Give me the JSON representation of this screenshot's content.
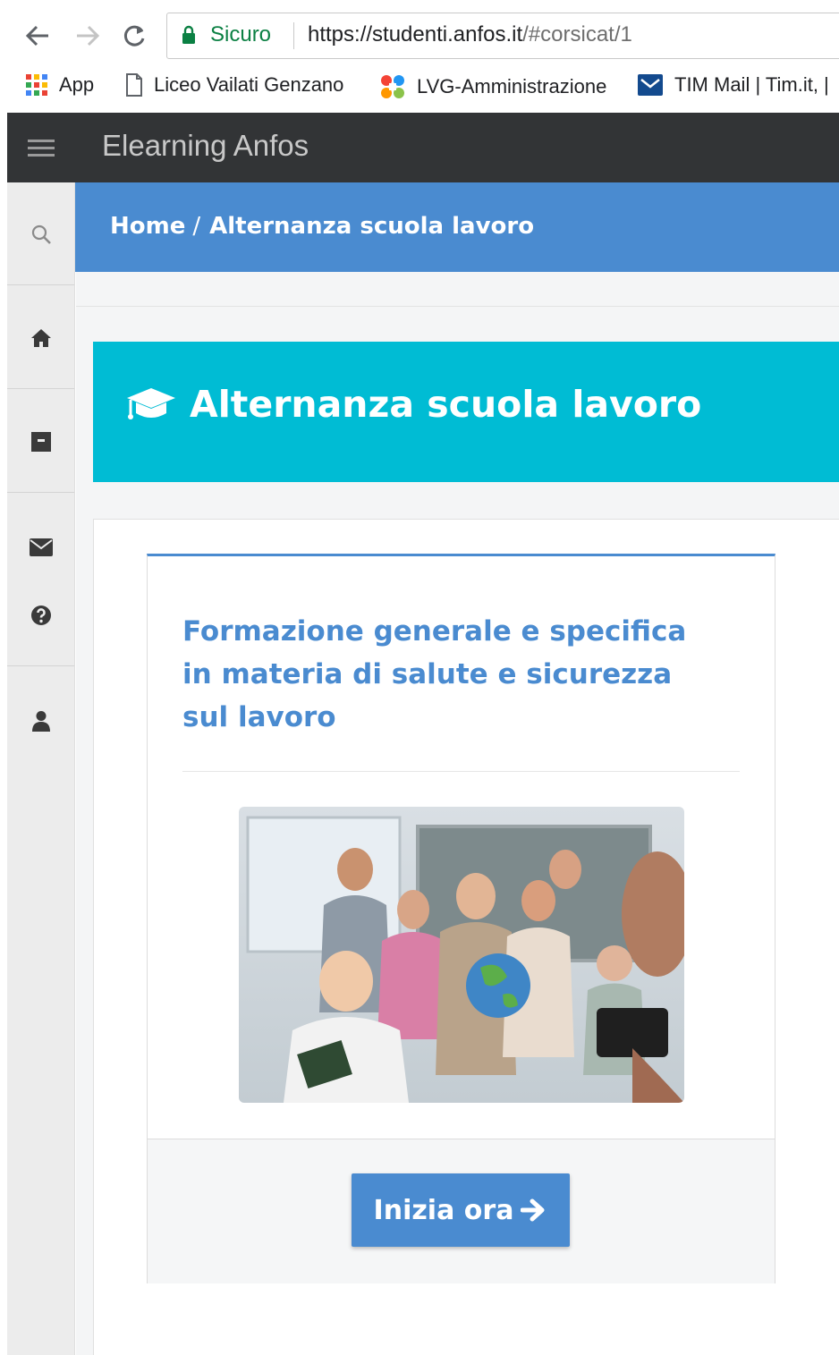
{
  "browser": {
    "secure_label": "Sicuro",
    "url_host": "https://studenti.anfos.it",
    "url_path": "/#corsicat/1",
    "bookmarks": [
      {
        "label": "App",
        "icon": "apps-grid-icon"
      },
      {
        "label": "Liceo Vailati Genzano",
        "icon": "page-icon"
      },
      {
        "label": "LVG-Amministrazione",
        "icon": "joomla-icon"
      },
      {
        "label": "TIM Mail | Tim.it, |",
        "icon": "mail-icon"
      }
    ]
  },
  "app": {
    "title": "Elearning Anfos"
  },
  "sidebar": {
    "items": [
      {
        "name": "search",
        "icon": "search-icon"
      },
      {
        "name": "home",
        "icon": "home-icon"
      },
      {
        "name": "archive",
        "icon": "archive-icon"
      },
      {
        "name": "messages",
        "icon": "envelope-icon"
      },
      {
        "name": "help",
        "icon": "question-circle-icon"
      },
      {
        "name": "profile",
        "icon": "user-icon"
      }
    ]
  },
  "breadcrumb": {
    "home": "Home",
    "separator": "/",
    "current": "Alternanza scuola lavoro"
  },
  "category": {
    "title": "Alternanza scuola lavoro",
    "icon": "graduation-cap-icon"
  },
  "course": {
    "title": "Formazione generale e specifica in materia di salute e sicurezza sul lavoro",
    "image": "group-photo-students-with-globe",
    "button_label": "Inizia ora",
    "button_icon": "arrow-right-icon"
  },
  "colors": {
    "header_dark": "#323436",
    "breadcrumb_blue": "#4a8bd0",
    "banner_cyan": "#00bcd4",
    "secure_green": "#0b8043"
  }
}
